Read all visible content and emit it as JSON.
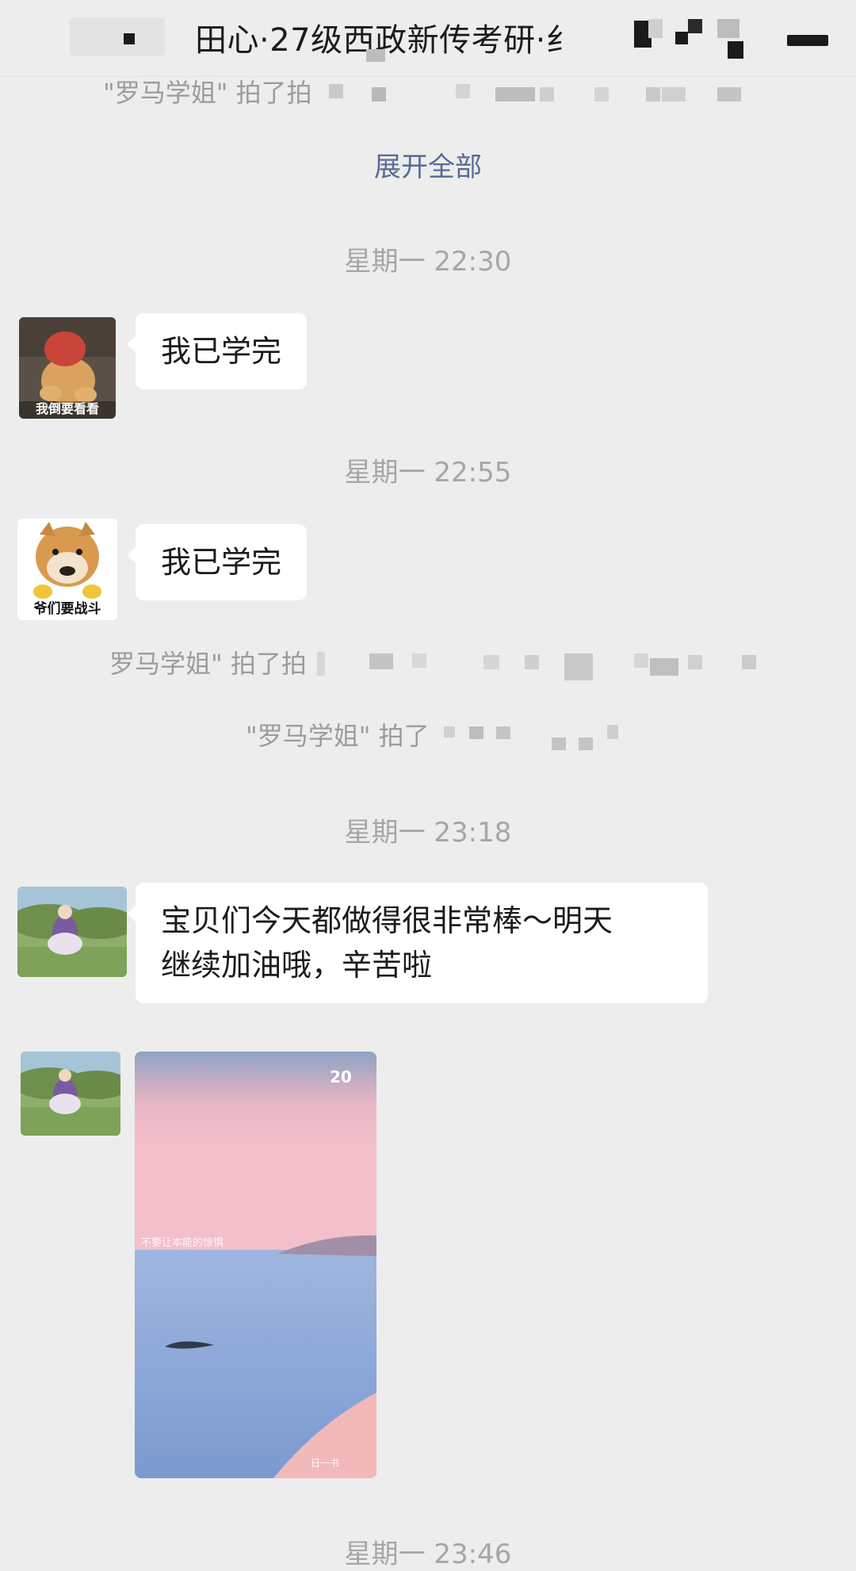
{
  "header": {
    "title": "田心·27级西政新传考研·纟",
    "menu_icon": "more-icon"
  },
  "system_messages": [
    {
      "text": "\"罗马学姐\" 拍了拍"
    },
    {
      "text": "罗马学姐\" 拍了拍"
    },
    {
      "text": "\"罗马学姐\" 拍了"
    }
  ],
  "expand_all": "展开全部",
  "timestamps": [
    "星期一 22:30",
    "星期一 22:55",
    "星期一 23:18",
    "星期一 23:46"
  ],
  "messages": [
    {
      "avatar_caption": "我倒要看看",
      "text": "我已学完"
    },
    {
      "avatar_caption": "爷们要战斗",
      "text": "我已学完"
    },
    {
      "text_line1": "宝贝们今天都做得很非常棒～明天",
      "text_line2": "继续加油哦，辛苦啦"
    }
  ],
  "image_message": {
    "badge_top": "20",
    "caption": "不要让本能的惊惧",
    "watermark": "日一书"
  },
  "colors": {
    "background": "#ededed",
    "bubble": "#ffffff",
    "link": "#576b95",
    "timestamp": "#a6a6a6"
  }
}
